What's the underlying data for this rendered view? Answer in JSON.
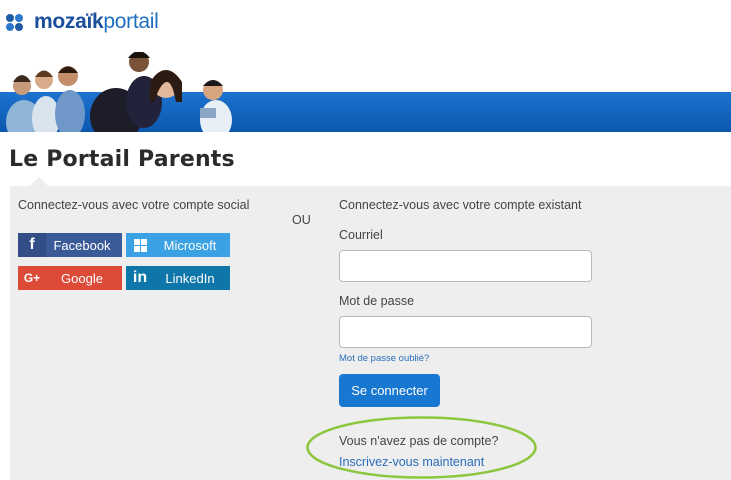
{
  "logo": {
    "brand_bold": "mozaïk",
    "brand_light": "portail"
  },
  "page": {
    "title": "Le Portail Parents"
  },
  "social": {
    "heading": "Connectez-vous avec votre compte social",
    "buttons": [
      {
        "label": "Facebook",
        "icon": "facebook-icon",
        "color": "#3b5a98"
      },
      {
        "label": "Microsoft",
        "icon": "microsoft-icon",
        "color": "#3aa1e5"
      },
      {
        "label": "Google",
        "icon": "google-plus-icon",
        "color": "#dd4a38"
      },
      {
        "label": "LinkedIn",
        "icon": "linkedin-icon",
        "color": "#0e76a8"
      }
    ]
  },
  "separator": "OU",
  "login": {
    "heading": "Connectez-vous avec votre compte existant",
    "email_label": "Courriel",
    "email_value": "",
    "password_label": "Mot de passe",
    "password_value": "",
    "forgot_link": "Mot de passe oublié?",
    "submit_label": "Se connecter"
  },
  "signup": {
    "question": "Vous n'avez pas de compte?",
    "link": "Inscrivez-vous maintenant"
  },
  "colors": {
    "brand_blue": "#1b4f9c",
    "banner_blue": "#0b57ae",
    "panel_bg": "#eeeeee",
    "primary_button": "#1877d0",
    "highlight_green": "#8cc63f"
  }
}
